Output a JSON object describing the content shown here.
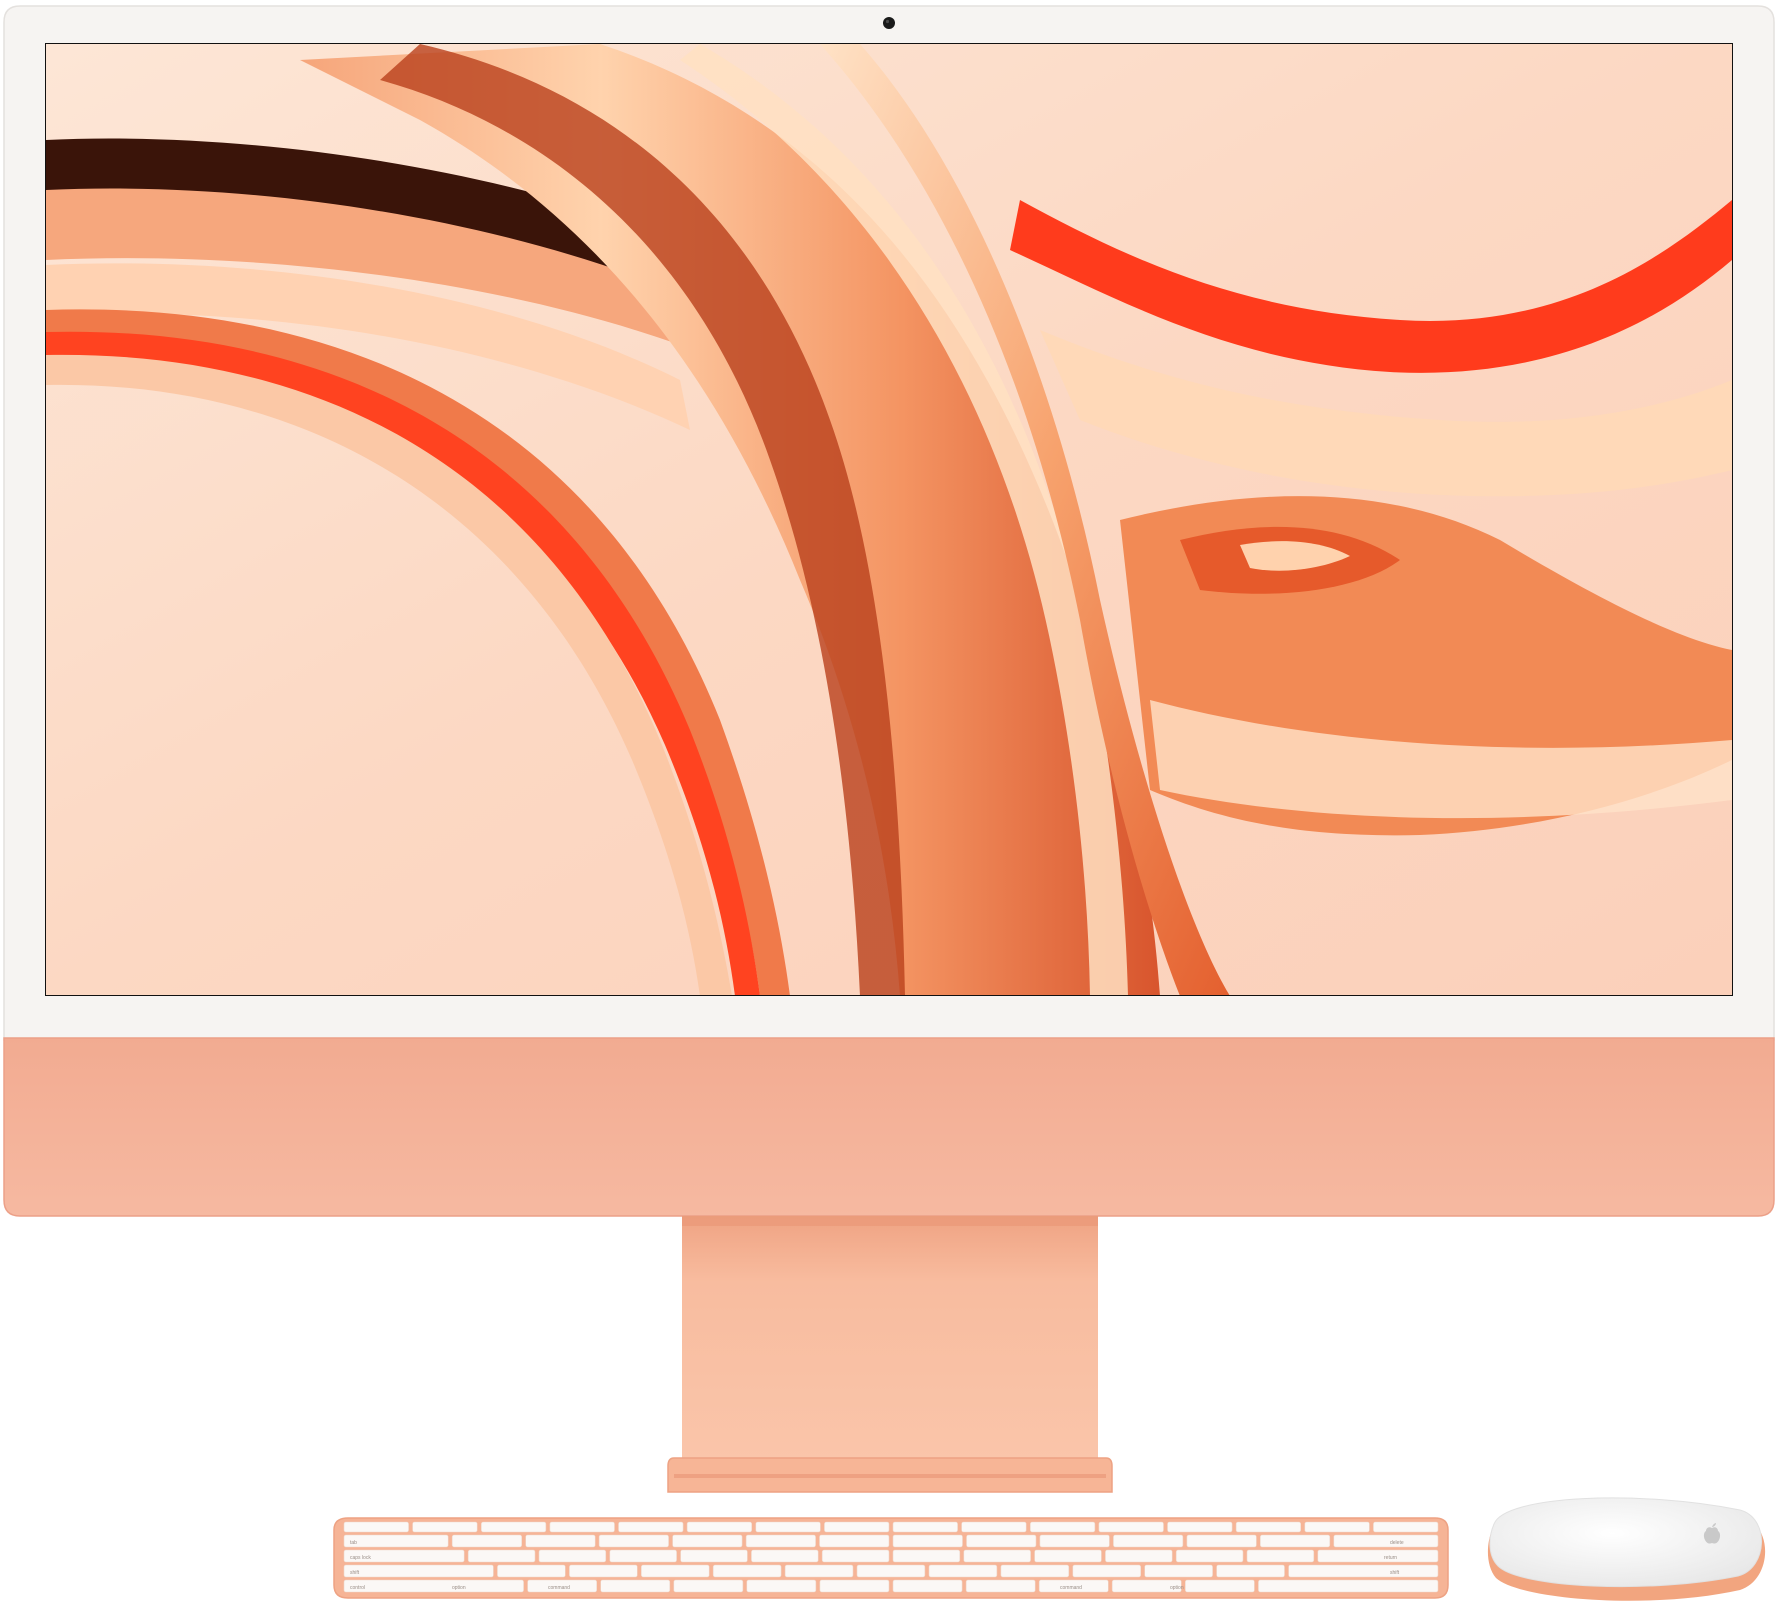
{
  "product": {
    "colors": {
      "chin": "#f4b39b",
      "chin_edge": "#f0a488",
      "bezel": "#f6f4f2",
      "stand": "#f8bc9f",
      "stand_shadow": "#eea485",
      "keyboard_frame": "#f6b496",
      "key": "#fbf8f6",
      "mouse_top": "#f2f2f2",
      "mouse_edge": "#f2a57f",
      "wallpaper_base": "#fbd7c4",
      "wallpaper_deep": "#e2552d",
      "wallpaper_red": "#ff3a1e",
      "wallpaper_light": "#ffe4cc"
    }
  },
  "keyboard": {
    "legends": [
      "tab",
      "caps lock",
      "shift",
      "control",
      "option",
      "command",
      "command",
      "option",
      "delete",
      "return",
      "shift"
    ]
  }
}
